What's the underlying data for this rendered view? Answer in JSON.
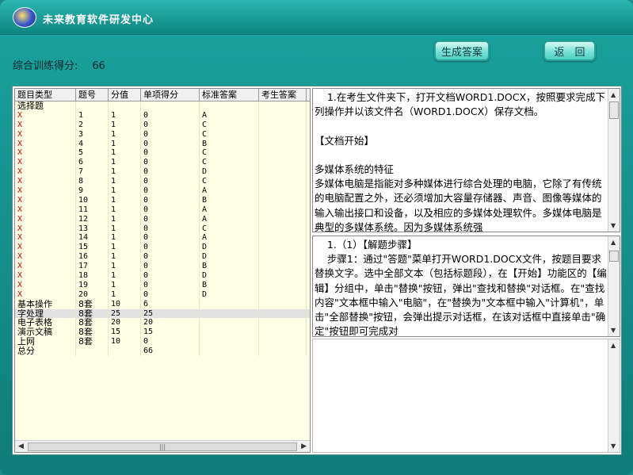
{
  "titlebar": {
    "title": "未来教育软件研发中心"
  },
  "buttons": {
    "generate_answer": "生成答案",
    "back": "返　回"
  },
  "score": {
    "label": "综合训练得分:",
    "value": "66"
  },
  "table": {
    "columns": [
      "题目类型",
      "题号",
      "分值",
      "单项得分",
      "标准答案",
      "考生答案"
    ],
    "rows": [
      [
        "选择题",
        "",
        "",
        "",
        "",
        ""
      ],
      [
        "X",
        "1",
        "1",
        "0",
        "A",
        ""
      ],
      [
        "X",
        "2",
        "1",
        "0",
        "C",
        ""
      ],
      [
        "X",
        "3",
        "1",
        "0",
        "C",
        ""
      ],
      [
        "X",
        "4",
        "1",
        "0",
        "B",
        ""
      ],
      [
        "X",
        "5",
        "1",
        "0",
        "C",
        ""
      ],
      [
        "X",
        "6",
        "1",
        "0",
        "C",
        ""
      ],
      [
        "X",
        "7",
        "1",
        "0",
        "D",
        ""
      ],
      [
        "X",
        "8",
        "1",
        "0",
        "C",
        ""
      ],
      [
        "X",
        "9",
        "1",
        "0",
        "A",
        ""
      ],
      [
        "X",
        "10",
        "1",
        "0",
        "B",
        ""
      ],
      [
        "X",
        "11",
        "1",
        "0",
        "A",
        ""
      ],
      [
        "X",
        "12",
        "1",
        "0",
        "A",
        ""
      ],
      [
        "X",
        "13",
        "1",
        "0",
        "C",
        ""
      ],
      [
        "X",
        "14",
        "1",
        "0",
        "A",
        ""
      ],
      [
        "X",
        "15",
        "1",
        "0",
        "D",
        ""
      ],
      [
        "X",
        "16",
        "1",
        "0",
        "D",
        ""
      ],
      [
        "X",
        "17",
        "1",
        "0",
        "B",
        ""
      ],
      [
        "X",
        "18",
        "1",
        "0",
        "D",
        ""
      ],
      [
        "X",
        "19",
        "1",
        "0",
        "B",
        ""
      ],
      [
        "X",
        "20",
        "1",
        "0",
        "D",
        ""
      ],
      [
        "基本操作",
        "8套",
        "10",
        "6",
        "",
        ""
      ],
      [
        "字处理",
        "8套",
        "25",
        "25",
        "",
        ""
      ],
      [
        "电子表格",
        "8套",
        "20",
        "20",
        "",
        ""
      ],
      [
        "演示文稿",
        "8套",
        "15",
        "15",
        "",
        ""
      ],
      [
        "上网",
        "8套",
        "10",
        "0",
        "",
        ""
      ],
      [
        "总分",
        "",
        "",
        "66",
        "",
        ""
      ]
    ]
  },
  "question_text": "    1.在考生文件夹下，打开文档WORD1.DOCX，按照要求完成下列操作并以该文件名（WORD1.DOCX）保存文档。\n\n【文档开始】\n\n多媒体系统的特征\n多媒体电脑是指能对多种媒体进行综合处理的电脑，它除了有传统的电脑配置之外，还必须增加大容量存储器、声音、图像等媒体的输入输出接口和设备，以及相应的多媒体处理软件。多媒体电脑是典型的多媒体系统。因为多媒体系统强",
  "solution_text": "    1.（1）【解题步骤】\n    步骤1：通过\"答题\"菜单打开WORD1.DOCX文件，按题目要求替换文字。选中全部文本（包括标题段），在【开始】功能区的【编辑】分组中，单击\"替换\"按钮，弹出\"查找和替换\"对话框。在\"查找内容\"文本框中输入\"电脑\"，在\"替换为\"文本框中输入\"计算机\"，单击\"全部替换\"按钮，会弹出提示对话框，在该对话框中直接单击\"确定\"按钮即可完成对",
  "colors": {
    "titlebar": "#1aa39e",
    "error_mark": "#cc0000",
    "grid_bg": "#ffffe6"
  }
}
